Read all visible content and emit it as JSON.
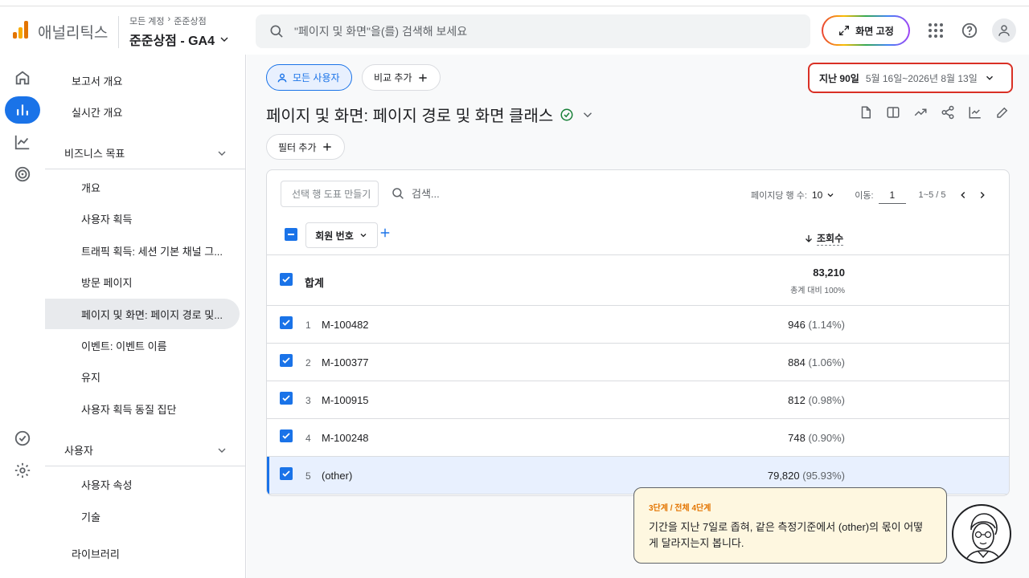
{
  "header": {
    "brand": "애널리틱스",
    "crumb_1": "모든 계정",
    "crumb_sep": "›",
    "crumb_2": "준준상점",
    "account_name": "준준상점 - GA4",
    "search_placeholder": "\"페이지 및 화면\"을(를) 검색해 보세요",
    "pin_label": "화면 고정"
  },
  "nav": {
    "report_overview": "보고서 개요",
    "realtime_overview": "실시간 개요",
    "business_goals": "비즈니스 목표",
    "items": [
      "개요",
      "사용자 획득",
      "트래픽 획득: 세션 기본 채널 그...",
      "방문 페이지",
      "페이지 및 화면: 페이지 경로 및...",
      "이벤트: 이벤트 이름",
      "유지",
      "사용자 획득 동질 집단"
    ],
    "users_section": "사용자",
    "user_items": [
      "사용자 속성",
      "기술"
    ],
    "library": "라이브러리"
  },
  "toolbar": {
    "all_users": "모든 사용자",
    "add_comparison": "비교 추가",
    "date_label": "지난 90일",
    "date_value": "5월 16일~2026년 8월 13일",
    "page_title": "페이지 및 화면: 페이지 경로 및 화면 클래스",
    "add_filter": "필터 추가"
  },
  "table": {
    "segment_button": "선택 행 도표 만들기",
    "search_placeholder": "검색...",
    "rows_per_page_label": "페이지당 행 수:",
    "rows_per_page": "10",
    "goto_label": "이동:",
    "goto_value": "1",
    "range": "1~5 / 5",
    "dimension": "회원 번호",
    "metric": "조회수",
    "total_label": "합계",
    "total_value": "83,210",
    "total_sub": "총계 대비 100%",
    "rows": [
      {
        "idx": "1",
        "name": "M-100482",
        "value": "946",
        "pct": "(1.14%)"
      },
      {
        "idx": "2",
        "name": "M-100377",
        "value": "884",
        "pct": "(1.06%)"
      },
      {
        "idx": "3",
        "name": "M-100915",
        "value": "812",
        "pct": "(0.98%)"
      },
      {
        "idx": "4",
        "name": "M-100248",
        "value": "748",
        "pct": "(0.90%)"
      },
      {
        "idx": "5",
        "name": "(other)",
        "value": "79,820",
        "pct": "(95.93%)"
      }
    ]
  },
  "tip": {
    "step": "3단계 / 전체 4단계",
    "message": "기간을 지난 7일로 좁혀, 같은 측정기준에서 (other)의 몫이 어떻게 달라지는지 봅니다."
  },
  "colors": {
    "accent": "#1a73e8",
    "highlight_border": "#d93025",
    "tip_bg": "#fef7e0",
    "brand_orange": "#e37400"
  }
}
